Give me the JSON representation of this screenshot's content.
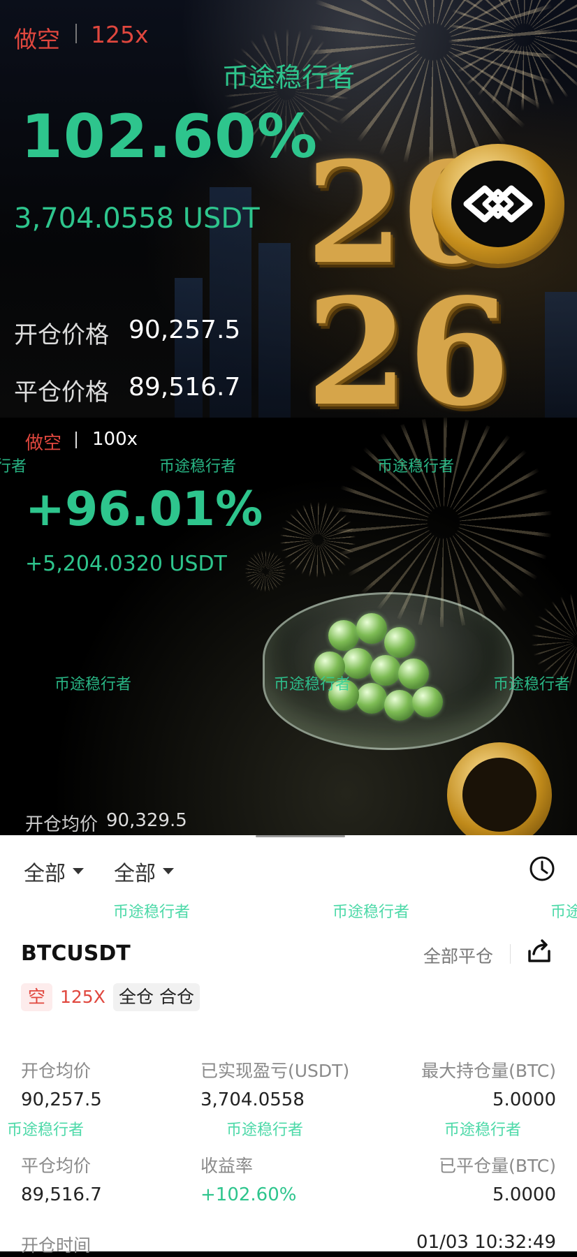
{
  "card1": {
    "side": "做空",
    "leverage": "125x",
    "watermark": "币途稳行者",
    "pnl_percent": "102.60%",
    "pnl_amount": "3,704.0558 USDT",
    "open_label": "开仓价格",
    "open_value": "90,257.5",
    "close_label": "平仓价格",
    "close_value": "89,516.7",
    "year_top": "20",
    "year_bottom": "26"
  },
  "card2": {
    "side": "做空",
    "leverage": "100x",
    "watermark": "币途稳行者",
    "watermark_cut": "行者",
    "pnl_percent": "+96.01%",
    "pnl_amount": "+5,204.0320 USDT",
    "avg_open_label": "开仓均价",
    "avg_open_value": "90,329.5"
  },
  "panel": {
    "filter1": "全部",
    "filter2": "全部",
    "watermark": "币途稳行者",
    "watermark_cut": "币途",
    "symbol": "BTCUSDT",
    "close_all": "全部平仓",
    "tag_side": "空",
    "tag_leverage": "125X",
    "tag_margin": "全仓 合仓",
    "row1": [
      {
        "label": "开仓均价",
        "value": "90,257.5"
      },
      {
        "label": "已实现盈亏(USDT)",
        "value": "3,704.0558"
      },
      {
        "label": "最大持仓量(BTC)",
        "value": "5.0000"
      }
    ],
    "row2": [
      {
        "label": "平仓均价",
        "value": "89,516.7"
      },
      {
        "label": "收益率",
        "value": "+102.60%"
      },
      {
        "label": "已平仓量(BTC)",
        "value": "5.0000"
      }
    ],
    "open_time_label": "开仓时间",
    "open_time_value": "01/03 10:32:49"
  },
  "colors": {
    "green": "#2ec58d",
    "red": "#e0473e",
    "gold": "#d6a54a"
  },
  "icons": [
    "history-clock-icon",
    "share-icon",
    "dropdown-caret-icon"
  ]
}
